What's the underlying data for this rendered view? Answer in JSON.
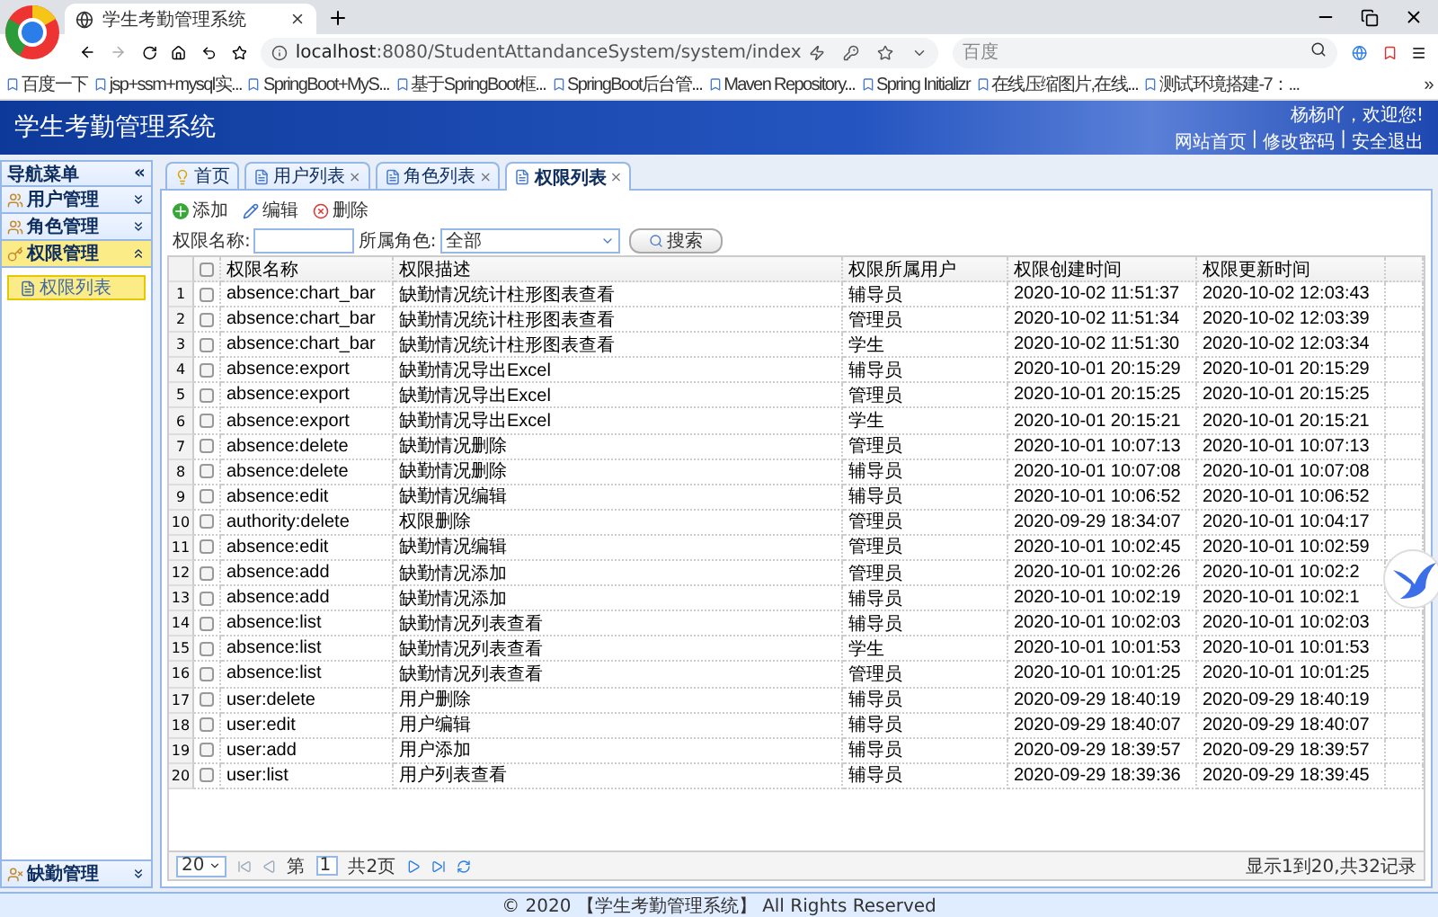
{
  "browser": {
    "tab_title": "学生考勤管理系统",
    "url_host": "localhost",
    "url_rest": ":8080/StudentAttandanceSystem/system/index",
    "search_placeholder": "百度",
    "bookmarks": [
      "百度一下",
      "jsp+ssm+mysql实...",
      "SpringBoot+MyS...",
      "基于SpringBoot框...",
      "SpringBoot后台管...",
      "Maven Repository...",
      "Spring Initializr",
      "在线压缩图片,在线...",
      "测试环境搭建-7：..."
    ],
    "more": "»"
  },
  "header": {
    "title": "学生考勤管理系统",
    "greeting": "杨杨吖，欢迎您!",
    "links": [
      "网站首页",
      "修改密码",
      "安全退出"
    ],
    "separator": "|"
  },
  "sidebar": {
    "title": "导航菜单",
    "collapse": "«",
    "groups": [
      {
        "label": "用户管理",
        "expanded": false
      },
      {
        "label": "角色管理",
        "expanded": false
      },
      {
        "label": "权限管理",
        "expanded": true,
        "items": [
          {
            "label": "权限列表",
            "selected": true
          }
        ]
      }
    ],
    "bottom_group": {
      "label": "缺勤管理",
      "expanded": false
    }
  },
  "tabs": [
    {
      "label": "首页",
      "selected": false,
      "closable": false,
      "kind": "home"
    },
    {
      "label": "用户列表",
      "selected": false,
      "closable": true,
      "kind": "page"
    },
    {
      "label": "角色列表",
      "selected": false,
      "closable": true,
      "kind": "page"
    },
    {
      "label": "权限列表",
      "selected": true,
      "closable": true,
      "kind": "page"
    }
  ],
  "close_mark": "×",
  "toolbar": [
    {
      "label": "添加",
      "kind": "add"
    },
    {
      "label": "编辑",
      "kind": "edit"
    },
    {
      "label": "删除",
      "kind": "delete"
    }
  ],
  "filter": {
    "name_label": "权限名称:",
    "role_label": "所属角色:",
    "role_value": "全部",
    "search_button": "搜索"
  },
  "table": {
    "all_checked": false,
    "columns": [
      "权限名称",
      "权限描述",
      "权限所属用户",
      "权限创建时间",
      "权限更新时间"
    ],
    "rows": [
      {
        "num": "1",
        "checked": false,
        "cells": [
          "absence:chart_bar",
          "缺勤情况统计柱形图表查看",
          "辅导员",
          "2020-10-02 11:51:37",
          "2020-10-02 12:03:43"
        ]
      },
      {
        "num": "2",
        "checked": false,
        "cells": [
          "absence:chart_bar",
          "缺勤情况统计柱形图表查看",
          "管理员",
          "2020-10-02 11:51:34",
          "2020-10-02 12:03:39"
        ]
      },
      {
        "num": "3",
        "checked": false,
        "cells": [
          "absence:chart_bar",
          "缺勤情况统计柱形图表查看",
          "学生",
          "2020-10-02 11:51:30",
          "2020-10-02 12:03:34"
        ]
      },
      {
        "num": "4",
        "checked": false,
        "cells": [
          "absence:export",
          "缺勤情况导出Excel",
          "辅导员",
          "2020-10-01 20:15:29",
          "2020-10-01 20:15:29"
        ]
      },
      {
        "num": "5",
        "checked": false,
        "cells": [
          "absence:export",
          "缺勤情况导出Excel",
          "管理员",
          "2020-10-01 20:15:25",
          "2020-10-01 20:15:25"
        ]
      },
      {
        "num": "6",
        "checked": false,
        "cells": [
          "absence:export",
          "缺勤情况导出Excel",
          "学生",
          "2020-10-01 20:15:21",
          "2020-10-01 20:15:21"
        ]
      },
      {
        "num": "7",
        "checked": false,
        "cells": [
          "absence:delete",
          "缺勤情况删除",
          "管理员",
          "2020-10-01 10:07:13",
          "2020-10-01 10:07:13"
        ]
      },
      {
        "num": "8",
        "checked": false,
        "cells": [
          "absence:delete",
          "缺勤情况删除",
          "辅导员",
          "2020-10-01 10:07:08",
          "2020-10-01 10:07:08"
        ]
      },
      {
        "num": "9",
        "checked": false,
        "cells": [
          "absence:edit",
          "缺勤情况编辑",
          "辅导员",
          "2020-10-01 10:06:52",
          "2020-10-01 10:06:52"
        ]
      },
      {
        "num": "10",
        "checked": false,
        "cells": [
          "authority:delete",
          "权限删除",
          "管理员",
          "2020-09-29 18:34:07",
          "2020-10-01 10:04:17"
        ]
      },
      {
        "num": "11",
        "checked": false,
        "cells": [
          "absence:edit",
          "缺勤情况编辑",
          "管理员",
          "2020-10-01 10:02:45",
          "2020-10-01 10:02:59"
        ]
      },
      {
        "num": "12",
        "checked": false,
        "cells": [
          "absence:add",
          "缺勤情况添加",
          "管理员",
          "2020-10-01 10:02:26",
          "2020-10-01 10:02:2"
        ]
      },
      {
        "num": "13",
        "checked": false,
        "cells": [
          "absence:add",
          "缺勤情况添加",
          "辅导员",
          "2020-10-01 10:02:19",
          "2020-10-01 10:02:1"
        ]
      },
      {
        "num": "14",
        "checked": false,
        "cells": [
          "absence:list",
          "缺勤情况列表查看",
          "辅导员",
          "2020-10-01 10:02:03",
          "2020-10-01 10:02:03"
        ]
      },
      {
        "num": "15",
        "checked": false,
        "cells": [
          "absence:list",
          "缺勤情况列表查看",
          "学生",
          "2020-10-01 10:01:53",
          "2020-10-01 10:01:53"
        ]
      },
      {
        "num": "16",
        "checked": false,
        "cells": [
          "absence:list",
          "缺勤情况列表查看",
          "管理员",
          "2020-10-01 10:01:25",
          "2020-10-01 10:01:25"
        ]
      },
      {
        "num": "17",
        "checked": false,
        "cells": [
          "user:delete",
          "用户删除",
          "辅导员",
          "2020-09-29 18:40:19",
          "2020-09-29 18:40:19"
        ]
      },
      {
        "num": "18",
        "checked": false,
        "cells": [
          "user:edit",
          "用户编辑",
          "辅导员",
          "2020-09-29 18:40:07",
          "2020-09-29 18:40:07"
        ]
      },
      {
        "num": "19",
        "checked": false,
        "cells": [
          "user:add",
          "用户添加",
          "辅导员",
          "2020-09-29 18:39:57",
          "2020-09-29 18:39:57"
        ]
      },
      {
        "num": "20",
        "checked": false,
        "cells": [
          "user:list",
          "用户列表查看",
          "辅导员",
          "2020-09-29 18:39:36",
          "2020-09-29 18:39:45"
        ]
      }
    ]
  },
  "pager": {
    "page_size": "20",
    "page_prefix": "第",
    "page": "1",
    "total_pages": "共2页",
    "summary": "显示1到20,共32记录"
  },
  "footer": "© 2020 【学生考勤管理系统】 All Rights Reserved"
}
